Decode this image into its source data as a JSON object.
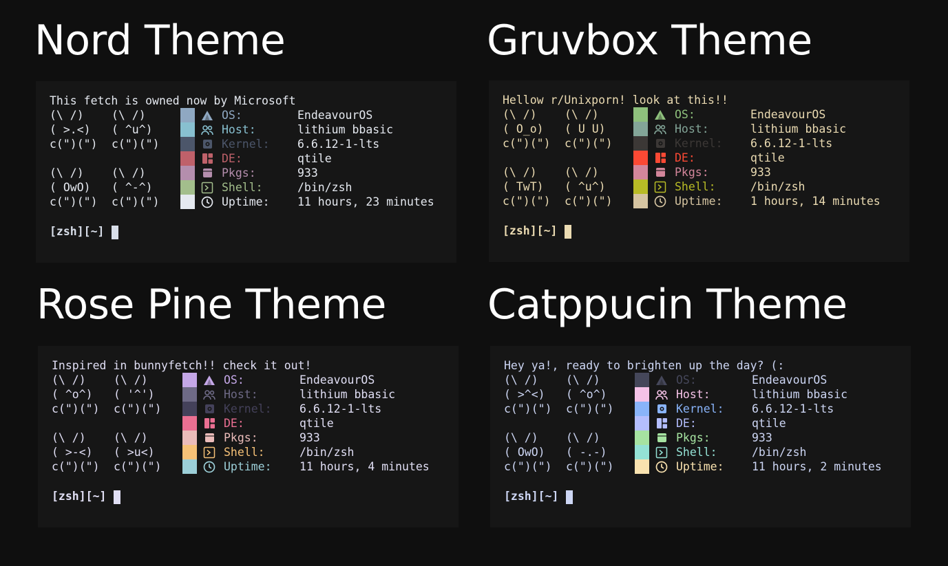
{
  "panels": [
    {
      "id": "nord",
      "title": "Nord Theme",
      "header": "This fetch is owned now by Microsoft",
      "fg": "#e5e9f0",
      "art": [
        [
          "(\\ /)",
          "(\\ /)"
        ],
        [
          "( >.<)",
          "( ^u^)"
        ],
        [
          "c(\")(\")",
          "c(\")(\")"
        ],
        [
          "",
          ""
        ],
        [
          "(\\ /)",
          "(\\ /)"
        ],
        [
          "( OwO)",
          "( ^-^)"
        ],
        [
          "c(\")(\")",
          "c(\")(\")"
        ]
      ],
      "swatches": [
        "#8fa8c2",
        "#88c0d0",
        "#4c566a",
        "#bf616a",
        "#b48ead",
        "#a3be8c",
        "#e5e9f0"
      ],
      "info": [
        {
          "icon": "arch-icon",
          "label": "OS:",
          "value": "EndeavourOS",
          "color": "#8fa8c2"
        },
        {
          "icon": "users-icon",
          "label": "Host:",
          "value": "lithium bbasic",
          "color": "#88c0d0"
        },
        {
          "icon": "chip-icon",
          "label": "Kernel:",
          "value": "6.6.12-1-lts",
          "color": "#4c566a"
        },
        {
          "icon": "layout-icon",
          "label": "DE:",
          "value": "qtile",
          "color": "#bf616a"
        },
        {
          "icon": "package-icon",
          "label": "Pkgs:",
          "value": "933",
          "color": "#b48ead"
        },
        {
          "icon": "terminal-icon",
          "label": "Shell:",
          "value": "/bin/zsh",
          "color": "#a3be8c"
        },
        {
          "icon": "clock-icon",
          "label": "Uptime:",
          "value": "11 hours, 23 minutes",
          "color": "#e5e9f0"
        }
      ],
      "prompt": "[zsh][~]",
      "prompt_color": "#d8dee9",
      "cursor_color": "#d8dee9"
    },
    {
      "id": "gruvbox",
      "title": "Gruvbox Theme",
      "header": "Hellow r/Unixporn! look at this!!",
      "fg": "#ebdbb2",
      "art": [
        [
          "(\\ /)",
          "(\\ /)"
        ],
        [
          "( O_o)",
          "( U U)"
        ],
        [
          "c(\")(\")",
          "c(\")(\")"
        ],
        [
          "",
          ""
        ],
        [
          "(\\ /)",
          "(\\ /)"
        ],
        [
          "( TwT)",
          "( ^u^)"
        ],
        [
          "c(\")(\")",
          "c(\")(\")"
        ]
      ],
      "swatches": [
        "#8ec07c",
        "#83a598",
        "#3c3836",
        "#fb4934",
        "#d3869b",
        "#b8bb26",
        "#d5c4a1"
      ],
      "info": [
        {
          "icon": "arch-icon",
          "label": "OS:",
          "value": "EndeavourOS",
          "color": "#8ec07c"
        },
        {
          "icon": "users-icon",
          "label": "Host:",
          "value": "lithium bbasic",
          "color": "#83a598"
        },
        {
          "icon": "chip-icon",
          "label": "Kernel:",
          "value": "6.6.12-1-lts",
          "color": "#3c3836"
        },
        {
          "icon": "layout-icon",
          "label": "DE:",
          "value": "qtile",
          "color": "#fb4934"
        },
        {
          "icon": "package-icon",
          "label": "Pkgs:",
          "value": "933",
          "color": "#d3869b"
        },
        {
          "icon": "terminal-icon",
          "label": "Shell:",
          "value": "/bin/zsh",
          "color": "#b8bb26"
        },
        {
          "icon": "clock-icon",
          "label": "Uptime:",
          "value": "1 hours, 14 minutes",
          "color": "#d5c4a1"
        }
      ],
      "prompt": "[zsh][~]",
      "prompt_color": "#ebdbb2",
      "cursor_color": "#ebdbb2"
    },
    {
      "id": "rosepine",
      "title": "Rose Pine Theme",
      "header": "Inspired in bunnyfetch!! check it out!",
      "fg": "#e0def4",
      "art": [
        [
          "(\\ /)",
          "(\\ /)"
        ],
        [
          "( ^o^)",
          "( '^')"
        ],
        [
          "c(\")(\")",
          "c(\")(\")"
        ],
        [
          "",
          ""
        ],
        [
          "(\\ /)",
          "(\\ /)"
        ],
        [
          "( >-<)",
          "( >u<)"
        ],
        [
          "c(\")(\")",
          "c(\")(\")"
        ]
      ],
      "swatches": [
        "#c4a7e7",
        "#6e6a86",
        "#44415a",
        "#eb6f92",
        "#ebbcba",
        "#f6c177",
        "#9ccfd8"
      ],
      "info": [
        {
          "icon": "arch-icon",
          "label": "OS:",
          "value": "EndeavourOS",
          "color": "#c4a7e7"
        },
        {
          "icon": "users-icon",
          "label": "Host:",
          "value": "lithium bbasic",
          "color": "#6e6a86"
        },
        {
          "icon": "chip-icon",
          "label": "Kernel:",
          "value": "6.6.12-1-lts",
          "color": "#44415a"
        },
        {
          "icon": "layout-icon",
          "label": "DE:",
          "value": "qtile",
          "color": "#eb6f92"
        },
        {
          "icon": "package-icon",
          "label": "Pkgs:",
          "value": "933",
          "color": "#ebbcba"
        },
        {
          "icon": "terminal-icon",
          "label": "Shell:",
          "value": "/bin/zsh",
          "color": "#f6c177"
        },
        {
          "icon": "clock-icon",
          "label": "Uptime:",
          "value": "11 hours, 4 minutes",
          "color": "#9ccfd8"
        }
      ],
      "prompt": "[zsh][~]",
      "prompt_color": "#e0def4",
      "cursor_color": "#e0def4"
    },
    {
      "id": "catppuccin",
      "title": "Catppucin Theme",
      "header": "Hey ya!, ready to brighten up the day? (:",
      "fg": "#cdd6f4",
      "art": [
        [
          "(\\ /)",
          "(\\ /)"
        ],
        [
          "( >^<)",
          "( ^o^)"
        ],
        [
          "c(\")(\")",
          "c(\")(\")"
        ],
        [
          "",
          ""
        ],
        [
          "(\\ /)",
          "(\\ /)"
        ],
        [
          "( OwO)",
          "( -.-)"
        ],
        [
          "c(\")(\")",
          "c(\")(\")"
        ]
      ],
      "swatches": [
        "#45475a",
        "#f5c2e7",
        "#89b4fa",
        "#b4befe",
        "#a6e3a1",
        "#94e2d5",
        "#f9e2af"
      ],
      "info": [
        {
          "icon": "arch-icon",
          "label": "OS:",
          "value": "EndeavourOS",
          "color": "#45475a"
        },
        {
          "icon": "users-icon",
          "label": "Host:",
          "value": "lithium bbasic",
          "color": "#f5c2e7"
        },
        {
          "icon": "chip-icon",
          "label": "Kernel:",
          "value": "6.6.12-1-lts",
          "color": "#89b4fa"
        },
        {
          "icon": "layout-icon",
          "label": "DE:",
          "value": "qtile",
          "color": "#b4befe"
        },
        {
          "icon": "package-icon",
          "label": "Pkgs:",
          "value": "933",
          "color": "#a6e3a1"
        },
        {
          "icon": "terminal-icon",
          "label": "Shell:",
          "value": "/bin/zsh",
          "color": "#94e2d5"
        },
        {
          "icon": "clock-icon",
          "label": "Uptime:",
          "value": "11 hours, 2 minutes",
          "color": "#f9e2af"
        }
      ],
      "prompt": "[zsh][~]",
      "prompt_color": "#cdd6f4",
      "cursor_color": "#cdd6f4"
    }
  ]
}
